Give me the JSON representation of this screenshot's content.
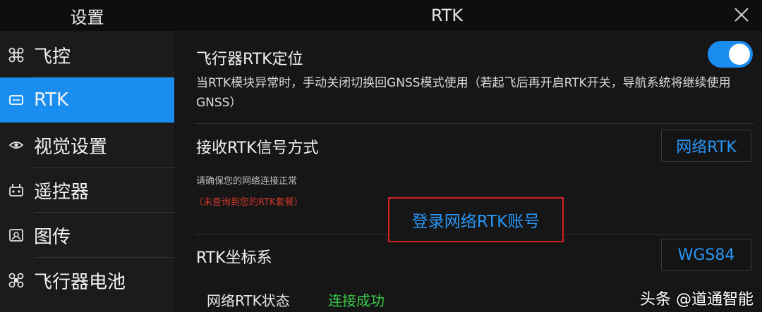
{
  "header": {
    "left_title": "设置",
    "title": "RTK",
    "close_icon": "close-icon"
  },
  "sidebar": {
    "items": [
      {
        "label": "飞控",
        "icon": "drone-icon",
        "active": false
      },
      {
        "label": "RTK",
        "icon": "rtk-icon",
        "active": true
      },
      {
        "label": "视觉设置",
        "icon": "eye-icon",
        "active": false
      },
      {
        "label": "遥控器",
        "icon": "remote-controller-icon",
        "active": false
      },
      {
        "label": "图传",
        "icon": "image-transmission-icon",
        "active": false
      },
      {
        "label": "飞行器电池",
        "icon": "drone-battery-icon",
        "active": false
      }
    ]
  },
  "main": {
    "rtk_positioning": {
      "title": "飞行器RTK定位",
      "enabled": true,
      "description": "当RTK模块异常时，手动关闭切换回GNSS模式使用（若起飞后再开启RTK开关，导航系统将继续使用GNSS）"
    },
    "signal_method": {
      "title": "接收RTK信号方式",
      "value": "网络RTK",
      "hint": "请确保您的网络连接正常",
      "warning": "（未查询到您的RTK套餐）",
      "login_label": "登录网络RTK账号"
    },
    "coordinate_system": {
      "title": "RTK坐标系",
      "value": "WGS84"
    },
    "network_status": {
      "label": "网络RTK状态",
      "value": "连接成功"
    }
  },
  "watermark": "头条 @道通智能",
  "colors": {
    "accent": "#1a8df0",
    "link_blue": "#2a95f5",
    "success_green": "#3cc94a",
    "warning_red": "#d0362b",
    "highlight_border": "#d42020"
  }
}
